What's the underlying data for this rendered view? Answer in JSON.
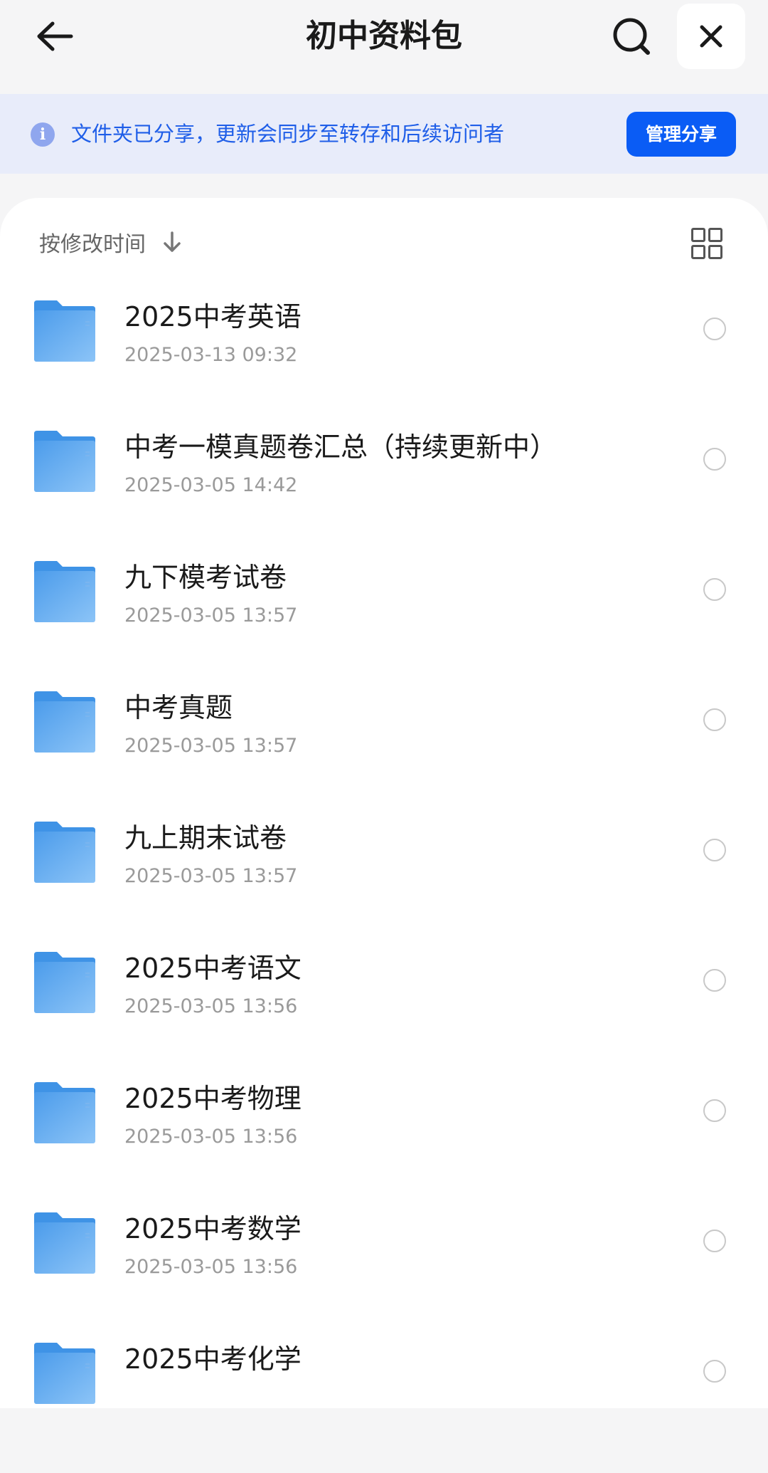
{
  "header": {
    "title": "初中资料包",
    "back_icon": "arrow-left-icon",
    "search_icon": "search-icon",
    "close_icon": "close-icon"
  },
  "banner": {
    "info_icon": "i",
    "text": "文件夹已分享，更新会同步至转存和后续访问者",
    "manage_label": "管理分享"
  },
  "sort": {
    "label": "按修改时间",
    "arrow_icon": "arrow-down-icon",
    "view_icon": "grid-icon"
  },
  "colors": {
    "accent": "#0a5cf5",
    "banner_bg": "#e8ecfa",
    "banner_text": "#1f5ee8",
    "folder": "#5aa8ee"
  },
  "files": [
    {
      "name": "2025中考英语",
      "date": "2025-03-13 09:32"
    },
    {
      "name": "中考一模真题卷汇总（持续更新中）",
      "date": "2025-03-05 14:42"
    },
    {
      "name": "九下模考试卷",
      "date": "2025-03-05 13:57"
    },
    {
      "name": "中考真题",
      "date": "2025-03-05 13:57"
    },
    {
      "name": "九上期末试卷",
      "date": "2025-03-05 13:57"
    },
    {
      "name": "2025中考语文",
      "date": "2025-03-05 13:56"
    },
    {
      "name": "2025中考物理",
      "date": "2025-03-05 13:56"
    },
    {
      "name": "2025中考数学",
      "date": "2025-03-05 13:56"
    },
    {
      "name": "2025中考化学",
      "date": ""
    }
  ]
}
